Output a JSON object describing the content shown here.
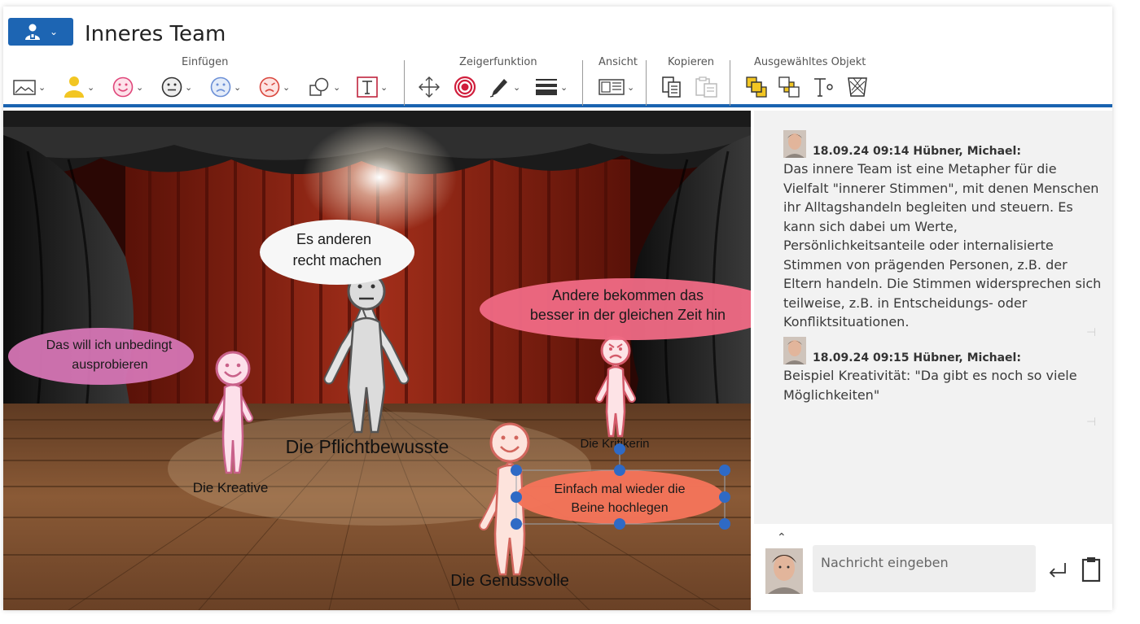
{
  "app": {
    "title": "Inneres Team"
  },
  "toolbar": {
    "groups": {
      "insert": "Einfügen",
      "pointer": "Zeigerfunktion",
      "view": "Ansicht",
      "copy": "Kopieren",
      "selected": "Ausgewähltes Objekt"
    }
  },
  "icons": {
    "user_menu": "user-icon",
    "image": "image-icon",
    "person": "person-icon",
    "happy": "smiley-happy-icon",
    "neutral": "smiley-neutral-icon",
    "sad": "smiley-sad-icon",
    "angry": "smiley-angry-icon",
    "shapes": "shapes-icon",
    "text": "text-box-icon",
    "move": "move-icon",
    "target": "target-icon",
    "pen": "pen-icon",
    "line_width": "line-width-icon",
    "view": "view-icon",
    "copy": "copy-icon",
    "paste": "paste-icon",
    "bring_front": "bring-to-front-icon",
    "send_back": "send-to-back-icon",
    "edit_text": "edit-text-icon",
    "delete": "trash-icon",
    "send": "send-icon",
    "clipboard": "clipboard-icon"
  },
  "colors": {
    "brand": "#1d65b3",
    "accent_yellow": "#f2c623",
    "smiley_pink": "#e0467a",
    "smiley_angry": "#d9453c",
    "selection": "#2f6ac5"
  },
  "stage": {
    "bubbles": [
      {
        "id": "pflicht",
        "line1": "Es anderen",
        "line2": "recht machen"
      },
      {
        "id": "kreativ",
        "line1": "Das will ich unbedingt",
        "line2": "ausprobieren"
      },
      {
        "id": "kritik",
        "line1": "Andere bekommen das",
        "line2": "besser in der gleichen Zeit hin"
      },
      {
        "id": "genuss",
        "line1": "Einfach mal wieder die",
        "line2": "Beine hochlegen"
      }
    ],
    "labels": {
      "pflicht": "Die Pflichtbewusste",
      "kreativ": "Die Kreative",
      "kritik": "Die Kritikerin",
      "genuss": "Die Genussvolle"
    }
  },
  "chat": {
    "messages": [
      {
        "meta": "18.09.24 09:14 Hübner, Michael:",
        "text": "Das innere Team ist eine Metapher für die Vielfalt \"innerer Stimmen\", mit denen Menschen ihr Alltagshandeln begleiten und steuern. Es kann sich dabei um Werte, Persönlichkeitsanteile oder internalisierte Stimmen von prägenden Personen, z.B. der Eltern handeln. Die Stimmen widersprechen sich teilweise, z.B. in Entscheidungs- oder Konfliktsituationen."
      },
      {
        "meta": "18.09.24 09:15 Hübner, Michael:",
        "text": "Beispiel Kreativität: \"Da gibt es noch so viele Möglichkeiten\""
      }
    ],
    "input_placeholder": "Nachricht eingeben"
  }
}
